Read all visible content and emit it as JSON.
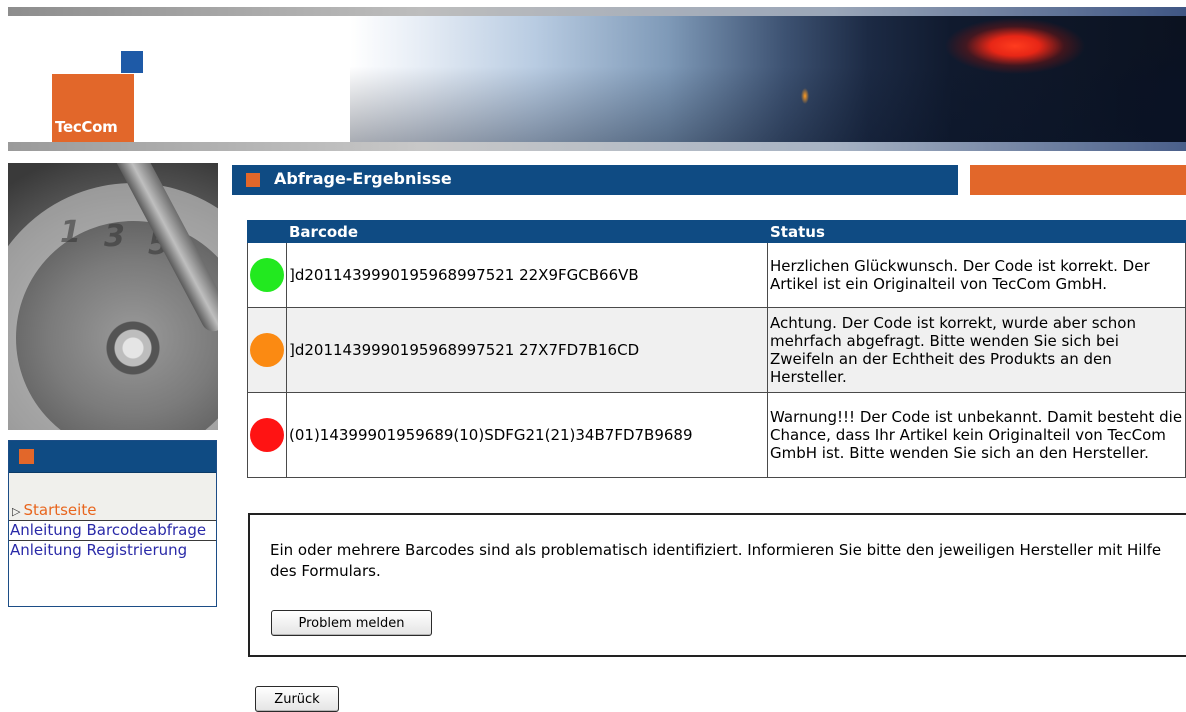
{
  "header": {
    "logo_text": "TecCom"
  },
  "sidebar": {
    "gear_numbers": [
      "1",
      "3",
      "5"
    ],
    "nav_items": [
      {
        "label": "Startseite"
      },
      {
        "label": "Anleitung Barcodeabfrage"
      },
      {
        "label": "Anleitung Registrierung"
      }
    ]
  },
  "section": {
    "title": "Abfrage-Ergebnisse"
  },
  "results": {
    "columns": [
      "",
      "Barcode",
      "Status"
    ],
    "rows": [
      {
        "indicator": "green",
        "barcode": "]d2011439990195968997521 22X9FGCB66VB",
        "status": "Herzlichen Glückwunsch. Der Code ist korrekt. Der Artikel ist ein Originalteil von TecCom GmbH."
      },
      {
        "indicator": "orange",
        "barcode": "]d2011439990195968997521 27X7FD7B16CD",
        "status": "Achtung. Der Code ist korrekt, wurde aber schon mehrfach abgefragt. Bitte wenden Sie sich bei Zweifeln an der Echtheit des Produkts an den Hersteller."
      },
      {
        "indicator": "red",
        "barcode": "(01)14399901959689(10)SDFG21(21)34B7FD7B9689",
        "status": "Warnung!!! Der Code ist unbekannt. Damit besteht die Chance, dass Ihr Artikel kein Originalteil von TecCom GmbH ist. Bitte wenden Sie sich an den Hersteller."
      }
    ]
  },
  "info": {
    "message": "Ein oder mehrere Barcodes sind als problematisch identifiziert. Informieren Sie bitte den jeweiligen Hersteller mit Hilfe des Formulars.",
    "problem_button": "Problem melden"
  },
  "footer": {
    "back_button": "Zurück"
  },
  "colors": {
    "navy": "#0f4b83",
    "orange": "#e2672a",
    "logo_blue": "#1e5aa7",
    "status_green": "#22e91f",
    "status_orange": "#fb8a12",
    "status_red": "#ff1313",
    "link": "#2a2aa8",
    "active_link": "#e8661e"
  }
}
